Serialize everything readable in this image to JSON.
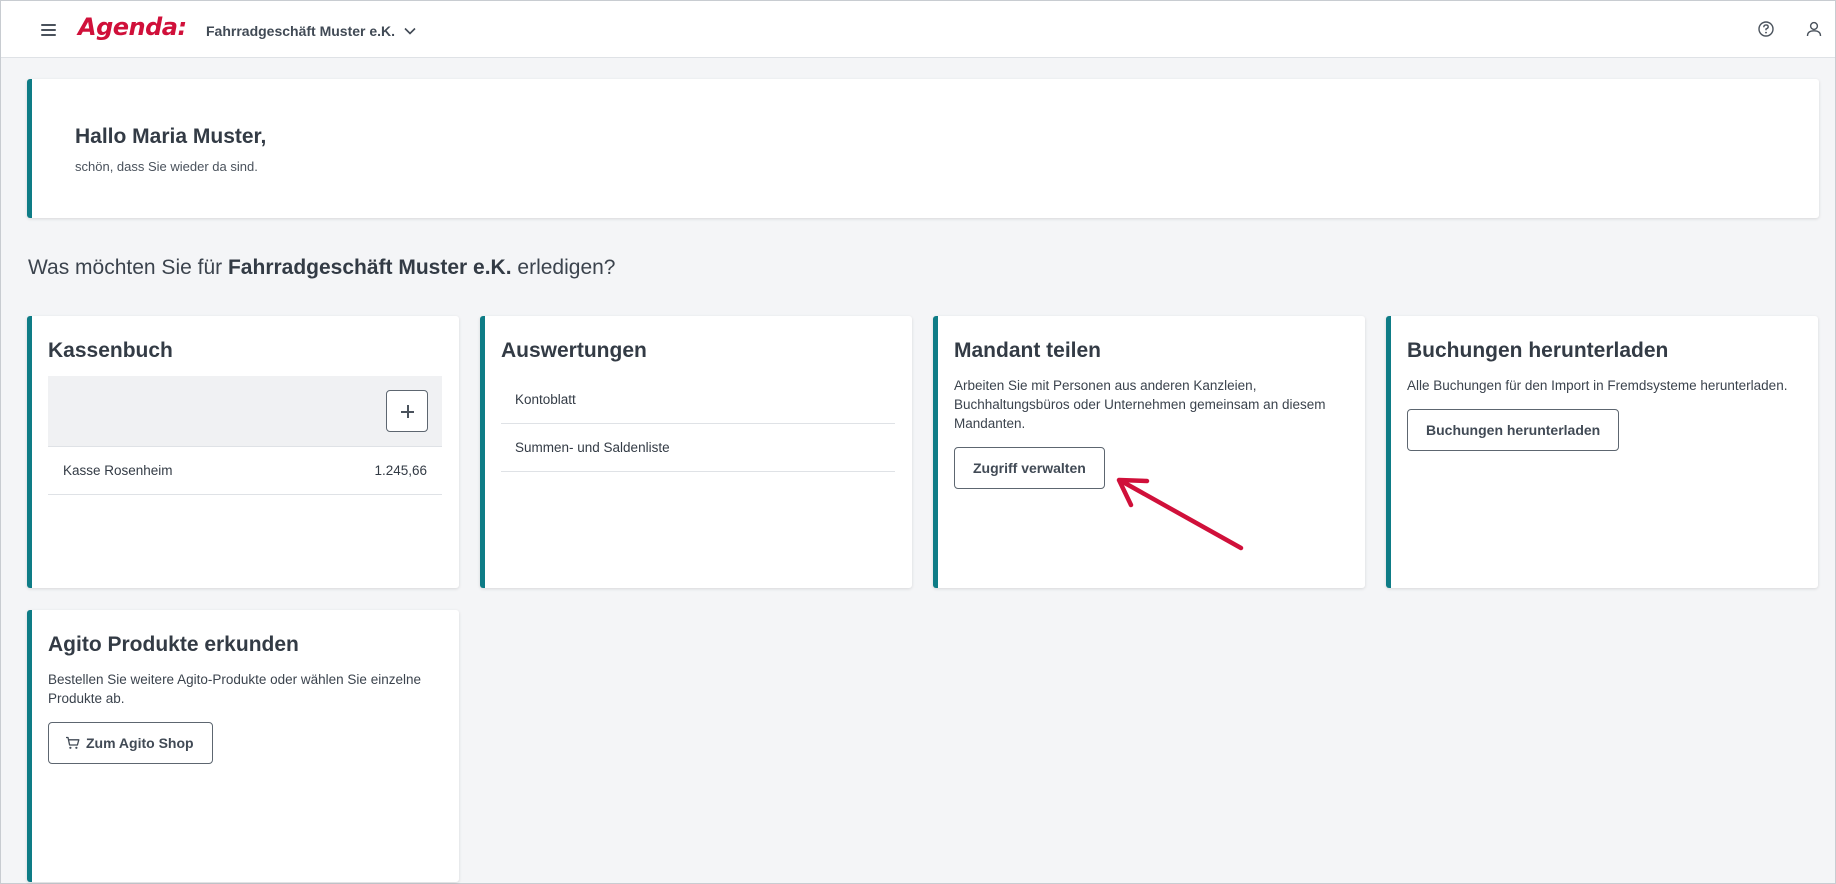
{
  "header": {
    "logo": "Agenda:",
    "company": "Fahrradgeschäft Muster e.K.",
    "icons": [
      "menu-icon",
      "chevron-down-icon",
      "help-icon",
      "user-icon"
    ]
  },
  "greeting": {
    "title": "Hallo Maria Muster,",
    "subtitle": "schön, dass Sie wieder da sind."
  },
  "question": {
    "prefix": "Was möchten Sie für",
    "company": "Fahrradgeschäft Muster e.K.",
    "suffix": "erledigen?"
  },
  "cards": {
    "kassenbuch": {
      "title": "Kassenbuch",
      "add_icon": "plus-icon",
      "rows": [
        {
          "name": "Kasse Rosenheim",
          "amount": "1.245,66"
        }
      ]
    },
    "auswertungen": {
      "title": "Auswertungen",
      "items": [
        "Kontoblatt",
        "Summen- und Saldenliste"
      ]
    },
    "mandant": {
      "title": "Mandant teilen",
      "desc": "Arbeiten Sie mit Personen aus anderen Kanzleien, Buchhaltungsbüros oder Unternehmen gemeinsam an diesem Mandanten.",
      "button": "Zugriff verwalten"
    },
    "buchungen": {
      "title": "Buchungen herunterladen",
      "desc": "Alle Buchungen für den Import in Fremdsysteme herunterladen.",
      "button": "Buchungen herunterladen"
    },
    "agito": {
      "title": "Agito Produkte erkunden",
      "desc": "Bestellen Sie weitere Agito-Produkte oder wählen Sie einzelne Produkte ab.",
      "button": "Zum Agito Shop",
      "button_icon": "cart-icon"
    }
  },
  "colors": {
    "accent": "#0e7c86",
    "brand": "#d0103a",
    "annotation_arrow": "#d0103a"
  }
}
